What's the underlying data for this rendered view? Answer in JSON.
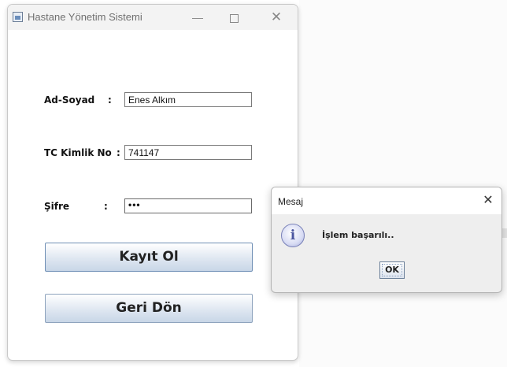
{
  "window": {
    "title": "Hastane Yönetim Sistemi",
    "icon": "java-app-icon",
    "controls": {
      "minimize": "—",
      "close": "✕"
    }
  },
  "form": {
    "fields": [
      {
        "label": "Ad-Soyad",
        "colon": ":",
        "value": "Enes Alkım"
      },
      {
        "label": "TC Kimlik No",
        "colon": ":",
        "value": "741147"
      },
      {
        "label": "Şifre",
        "colon": ":",
        "value": "•••"
      }
    ],
    "buttons": {
      "register": "Kayıt Ol",
      "back": "Geri Dön"
    }
  },
  "dialog": {
    "title": "Mesaj",
    "close": "✕",
    "icon": "info-icon",
    "icon_glyph": "i",
    "message": "İşlem başarılı..",
    "ok_label": "OK"
  }
}
